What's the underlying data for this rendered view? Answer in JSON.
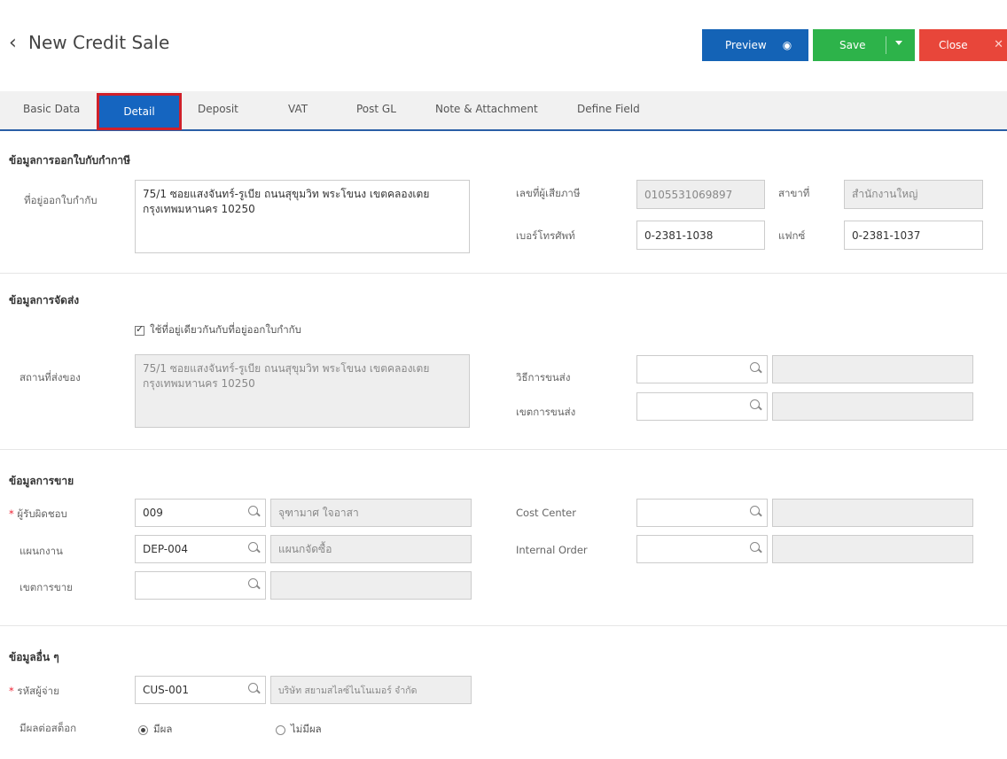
{
  "header": {
    "back_icon": "chevron-left-icon",
    "title": "New Credit Sale",
    "preview_label": "Preview",
    "save_label": "Save",
    "close_label": "Close",
    "colors": {
      "preview": "#1463b6",
      "save": "#2db34a",
      "close": "#e8463a"
    }
  },
  "tabs": [
    {
      "label": "Basic Data"
    },
    {
      "label": "Detail",
      "active": true
    },
    {
      "label": "Deposit"
    },
    {
      "label": "VAT"
    },
    {
      "label": "Post GL"
    },
    {
      "label": "Note & Attachment"
    },
    {
      "label": "Define Field"
    }
  ],
  "invoice": {
    "section_title": "ข้อมูลการออกใบกับกำกาษี",
    "address_label": "ที่อยู่ออกใบกำกับ",
    "address_value": "75/1 ซอยแสงจันทร์-รูเบีย ถนนสุขุมวิท พระโขนง เขตคลองเตย กรุงเทพมหานคร 10250",
    "tax_id_label": "เลขที่ผู้เสียภาษี",
    "tax_id_value": "0105531069897",
    "branch_label": "สาขาที่",
    "branch_value": "สำนักงานใหญ่",
    "phone_label": "เบอร์โทรศัพท์",
    "phone_value": "0-2381-1038",
    "fax_label": "แฟกซ์",
    "fax_value": "0-2381-1037"
  },
  "shipping": {
    "section_title": "ข้อมูลการจัดส่ง",
    "same_address_label": "ใช้ที่อยู่เดียวกันกับที่อยู่ออกใบกำกับ",
    "same_address_checked": true,
    "ship_to_label": "สถานที่ส่งของ",
    "ship_to_value": "75/1 ซอยแสงจันทร์-รูเบีย ถนนสุขุมวิท พระโขนง เขตคลองเตย กรุงเทพมหานคร 10250",
    "method_label": "วิธีการขนส่ง",
    "method_value": "",
    "zone_label": "เขตการขนส่ง",
    "zone_value": ""
  },
  "sales": {
    "section_title": "ข้อมูลการขาย",
    "responsible_label": "ผู้รับผิดชอบ",
    "responsible_code": "009",
    "responsible_name": "จุฑามาศ ใจอาสา",
    "department_label": "แผนกงาน",
    "department_code": "DEP-004",
    "department_name": "แผนกจัดซื้อ",
    "sales_area_label": "เขตการขาย",
    "sales_area_code": "",
    "sales_area_name": "",
    "cost_center_label": "Cost Center",
    "cost_center_code": "",
    "cost_center_name": "",
    "internal_order_label": "Internal Order",
    "internal_order_code": "",
    "internal_order_name": ""
  },
  "other": {
    "section_title": "ข้อมูลอื่น ๆ",
    "payer_label": "รหัสผู้จ่าย",
    "payer_code": "CUS-001",
    "payer_name": "บริษัท สยามสไลซ์ไนโนเมอร์ จำกัด",
    "stock_label": "มีผลต่อสต็อก",
    "stock_yes_label": "มีผล",
    "stock_no_label": "ไม่มีผล",
    "stock_selected": "yes"
  }
}
